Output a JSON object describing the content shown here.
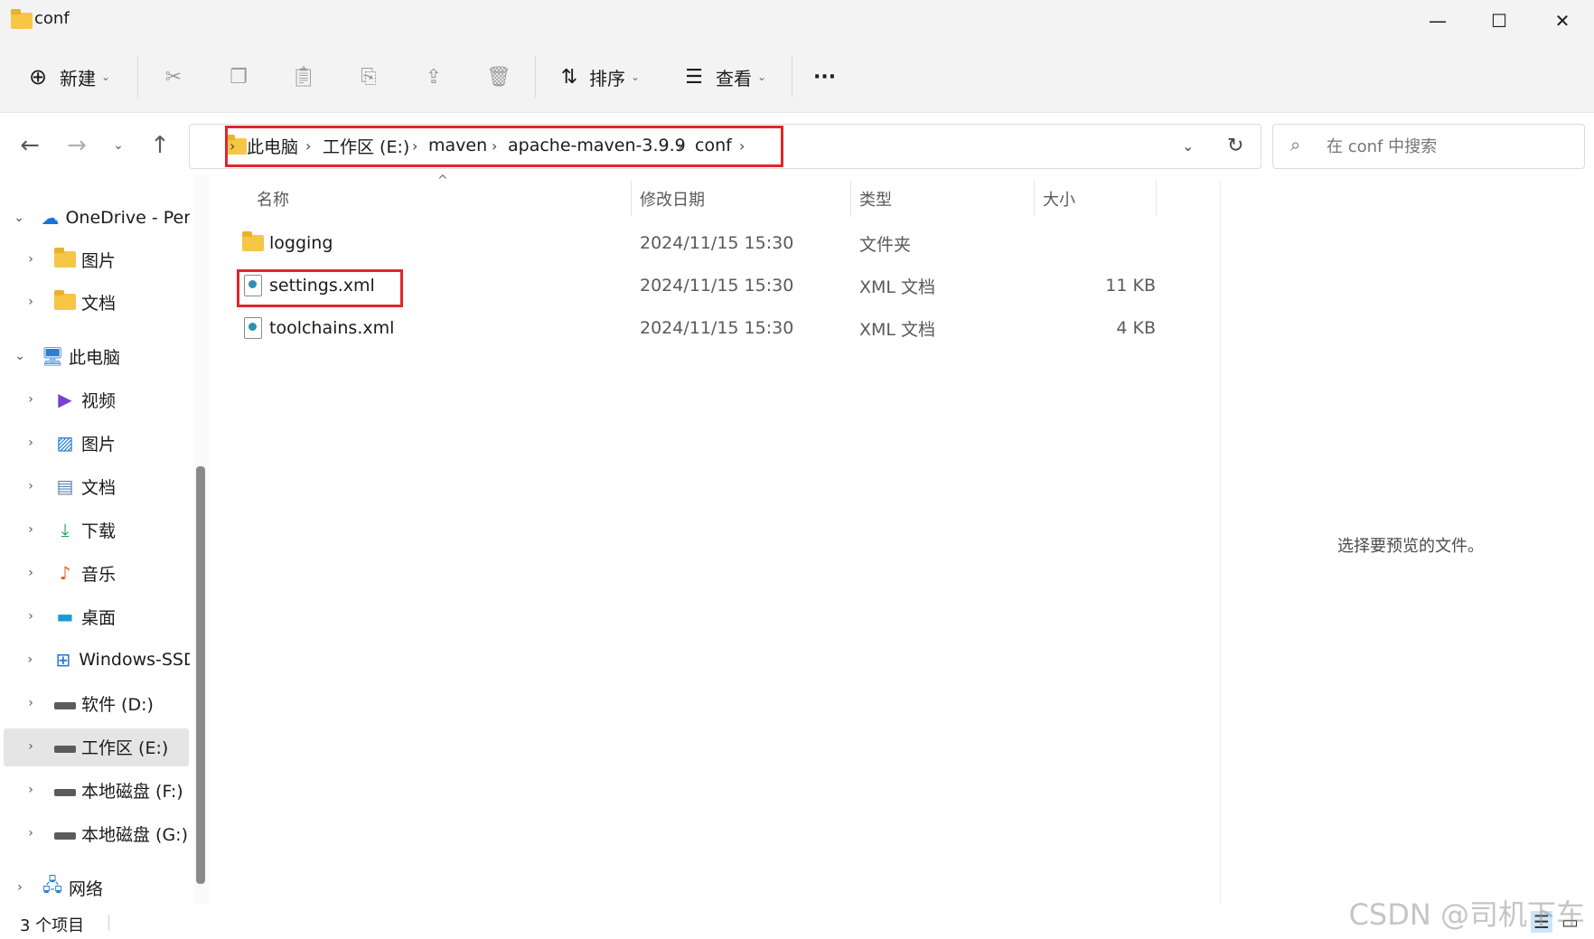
{
  "window": {
    "title": "conf",
    "minimize_icon": "minimize-icon",
    "maximize_icon": "maximize-icon",
    "close_icon": "close-icon"
  },
  "toolbar": {
    "new_label": "新建",
    "sort_label": "排序",
    "view_label": "查看",
    "more_label": "···"
  },
  "address": {
    "crumbs": [
      "此电脑",
      "工作区 (E:)",
      "maven",
      "apache-maven-3.9.9",
      "conf"
    ]
  },
  "search": {
    "placeholder": "在 conf 中搜索"
  },
  "sidebar": {
    "items": [
      {
        "label": "OneDrive - Pers",
        "icon": "onedrive-icon",
        "expanded": true,
        "level": 0
      },
      {
        "label": "图片",
        "icon": "folder-icon",
        "level": 1
      },
      {
        "label": "文档",
        "icon": "folder-icon",
        "level": 1
      },
      {
        "label": "此电脑",
        "icon": "pc-icon",
        "expanded": true,
        "level": 0
      },
      {
        "label": "视频",
        "icon": "video-icon",
        "level": 1
      },
      {
        "label": "图片",
        "icon": "pictures-icon",
        "level": 1
      },
      {
        "label": "文档",
        "icon": "documents-icon",
        "level": 1
      },
      {
        "label": "下载",
        "icon": "download-icon",
        "level": 1
      },
      {
        "label": "音乐",
        "icon": "music-icon",
        "level": 1
      },
      {
        "label": "桌面",
        "icon": "desktop-icon",
        "level": 1
      },
      {
        "label": "Windows-SSD",
        "icon": "windows-drive-icon",
        "level": 1
      },
      {
        "label": "软件 (D:)",
        "icon": "drive-icon",
        "level": 1
      },
      {
        "label": "工作区 (E:)",
        "icon": "drive-icon",
        "level": 1,
        "selected": true
      },
      {
        "label": "本地磁盘 (F:)",
        "icon": "drive-icon",
        "level": 1
      },
      {
        "label": "本地磁盘 (G:)",
        "icon": "drive-icon",
        "level": 1
      },
      {
        "label": "网络",
        "icon": "network-icon",
        "level": 0
      }
    ]
  },
  "columns": {
    "name": "名称",
    "modified": "修改日期",
    "type": "类型",
    "size": "大小"
  },
  "files": [
    {
      "name": "logging",
      "modified": "2024/11/15 15:30",
      "type": "文件夹",
      "size": "",
      "icon": "folder-icon"
    },
    {
      "name": "settings.xml",
      "modified": "2024/11/15 15:30",
      "type": "XML 文档",
      "size": "11 KB",
      "icon": "xml-file-icon"
    },
    {
      "name": "toolchains.xml",
      "modified": "2024/11/15 15:30",
      "type": "XML 文档",
      "size": "4 KB",
      "icon": "xml-file-icon"
    }
  ],
  "preview": {
    "message": "选择要预览的文件。"
  },
  "status": {
    "count": "3 个项目"
  },
  "watermark": "CSDN @司机下车",
  "colors": {
    "highlight_box": "#e0262b",
    "selected_bg": "#e5e5e5",
    "folder": "#f6c645"
  }
}
